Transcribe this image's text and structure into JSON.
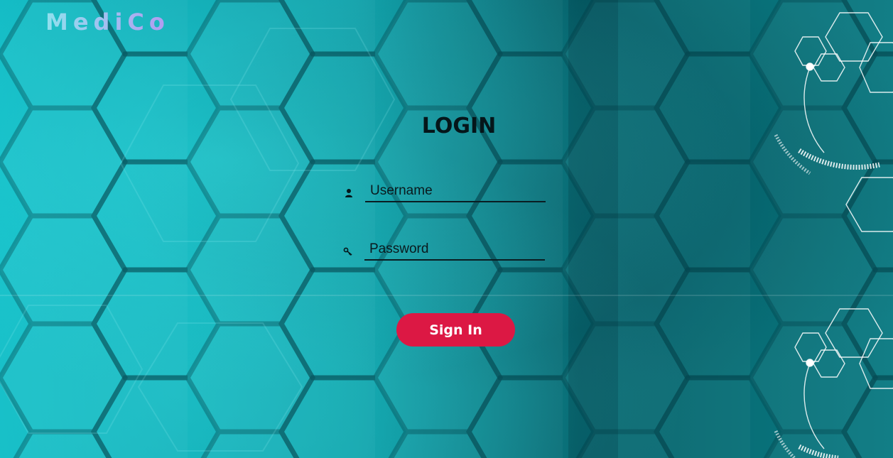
{
  "brand": {
    "name": "MediCo"
  },
  "login": {
    "title": "LOGIN",
    "username_placeholder": "Username",
    "password_placeholder": "Password",
    "submit_label": "Sign In"
  },
  "icons": {
    "username": "user-icon",
    "password": "key-icon"
  },
  "colors": {
    "primary_button": "#dc1844",
    "background_teal": "#0a7f86",
    "logo_gradient_start": "#8fe0ee",
    "logo_gradient_end": "#b29af0"
  }
}
